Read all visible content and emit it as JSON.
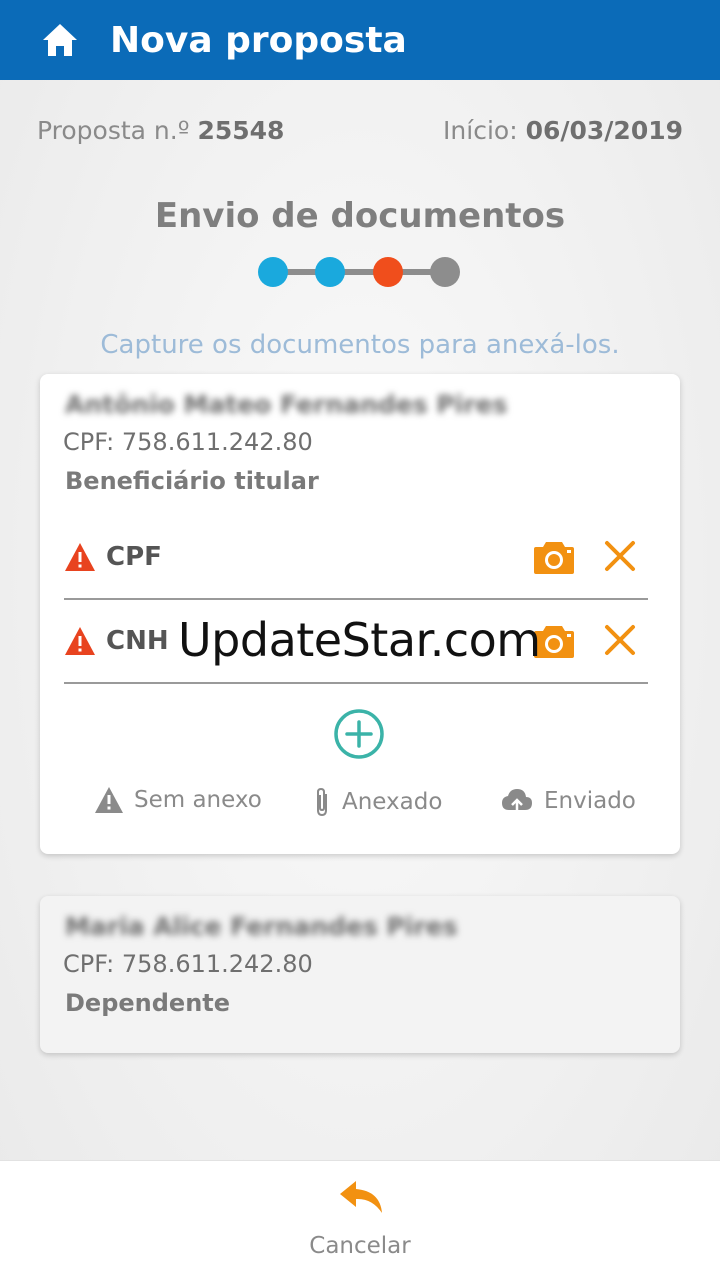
{
  "header": {
    "title": "Nova proposta",
    "icon": "home-icon"
  },
  "proposal": {
    "number_label": "Proposta n.º",
    "number": "25548",
    "start_label": "Início:",
    "start_date": "06/03/2019"
  },
  "section": {
    "title": "Envio de documentos",
    "hint": "Capture os documentos para anexá-los."
  },
  "stepper": {
    "total_steps": 4,
    "current_step": 3,
    "colors": {
      "done": "#1aa9dd",
      "current": "#f04e1c",
      "pending": "#8d8d8d"
    }
  },
  "beneficiaries": [
    {
      "name": "Antônio Mateo Fernandes Pires",
      "cpf": "CPF: 758.611.242.80",
      "role": "Beneficiário titular",
      "documents": [
        {
          "label": "CPF",
          "status": "warning-icon"
        },
        {
          "label": "CNH",
          "status": "warning-icon"
        }
      ]
    },
    {
      "name": "Maria Alice Fernandes Pires",
      "cpf": "CPF: 758.611.242.80",
      "role": "Dependente"
    }
  ],
  "watermark": "UpdateStar.com",
  "legend": {
    "no_attachment": "Sem anexo",
    "attached": "Anexado",
    "sent": "Enviado"
  },
  "footer": {
    "cancel_label": "Cancelar"
  },
  "colors": {
    "brand": "#0b6bb8",
    "accent": "#f29111",
    "warning": "#e8431f",
    "add": "#3bb3a8"
  }
}
